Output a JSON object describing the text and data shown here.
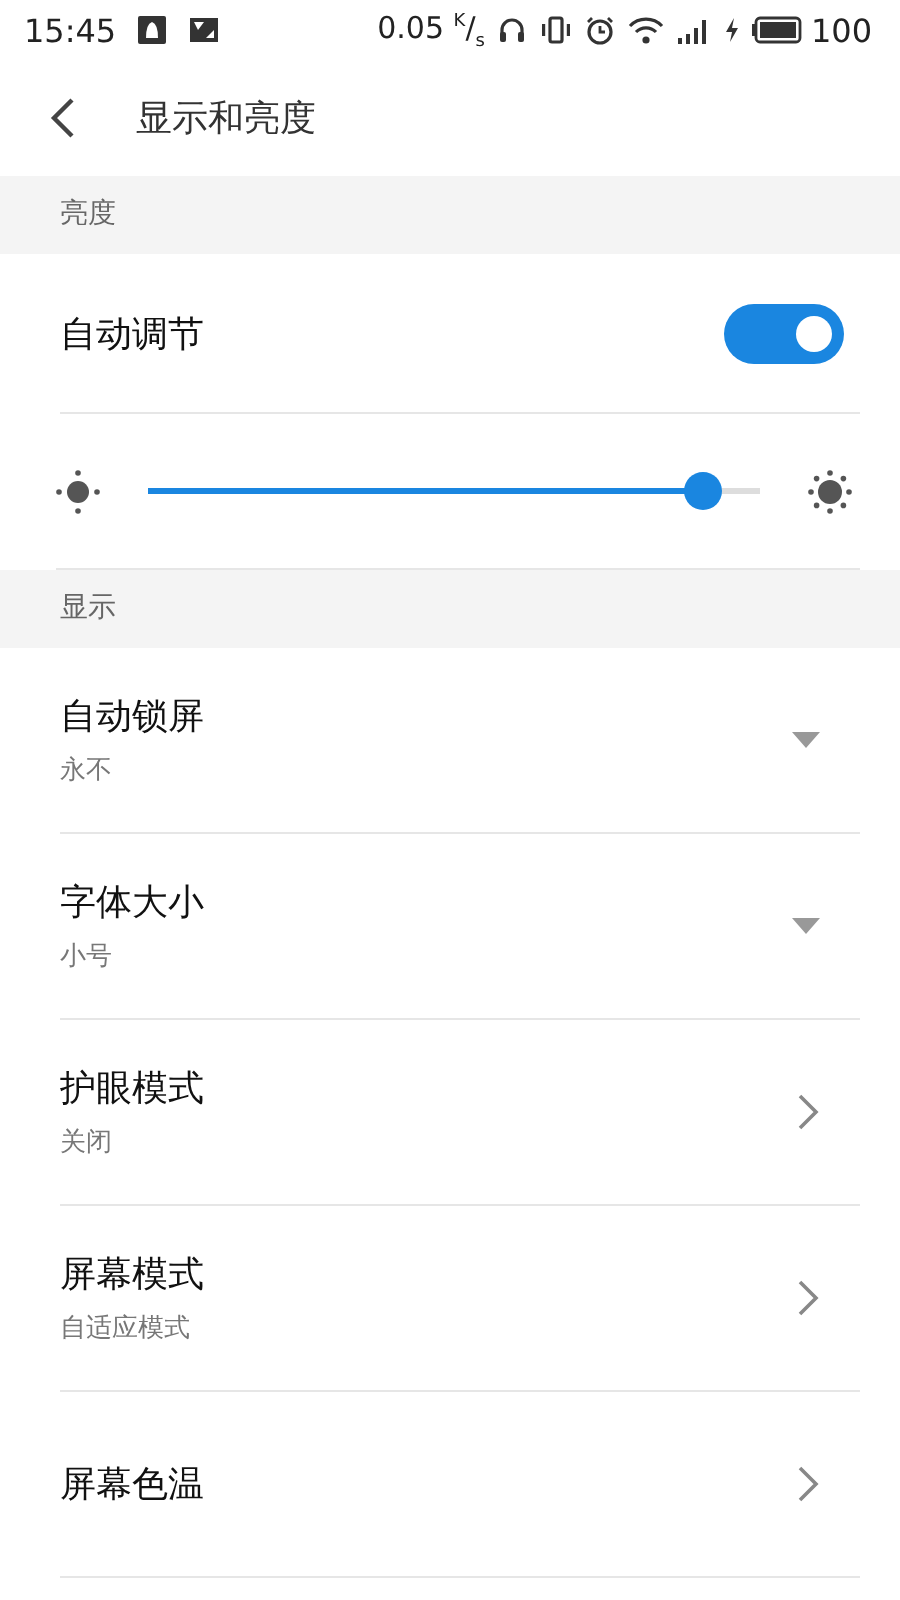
{
  "status_bar": {
    "time": "15:45",
    "net_speed": "0.05 $^{K}$/$_{s}$",
    "battery": "100"
  },
  "header": {
    "title": "显示和亮度"
  },
  "sections": [
    {
      "title": "亮度",
      "rows": [
        {
          "kind": "toggle",
          "label": "自动调节",
          "on": true
        },
        {
          "kind": "slider",
          "level": 0.91
        }
      ]
    },
    {
      "title": "显示",
      "rows": [
        {
          "kind": "dropdown",
          "label": "自动锁屏",
          "value": "永不"
        },
        {
          "kind": "dropdown",
          "label": "字体大小",
          "value": "小号"
        },
        {
          "kind": "link",
          "label": "护眼模式",
          "value": "关闭"
        },
        {
          "kind": "link",
          "label": "屏幕模式",
          "value": "自适应模式"
        },
        {
          "kind": "link",
          "label": "屏幕色温"
        }
      ]
    }
  ]
}
